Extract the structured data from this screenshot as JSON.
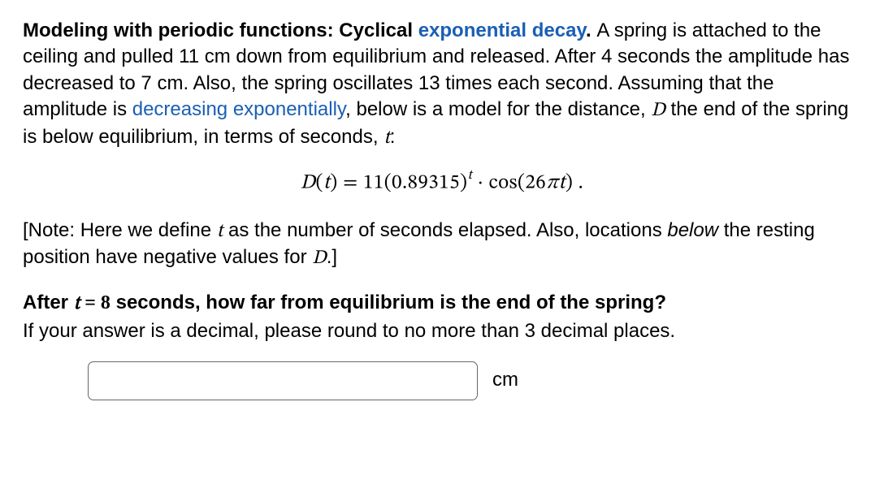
{
  "intro": {
    "title_bold": "Modeling with periodic functions: Cyclical ",
    "title_link": "exponential decay",
    "title_after": ". ",
    "body_part1": "A spring is attached to the ceiling and pulled 11 cm down from equilibrium and released. After 4 seconds the amplitude has decreased to 7 cm. Also, the spring oscillates 13 times each second. Assuming that the amplitude is ",
    "body_link2": "decreasing exponentially",
    "body_part2": ", below is a model for the distance, ",
    "body_D": "D",
    "body_part3": " the end of the spring is below equilibrium, in terms of seconds, ",
    "body_t": "t",
    "body_end": ":"
  },
  "formula": {
    "D": "D",
    "open": "(",
    "t": "t",
    "close_eq": ") = 11(0.89315)",
    "sup": "t",
    "dot_cos": " · cos(26",
    "pi": "π",
    "t2": "t",
    "end": ")  ."
  },
  "note": {
    "open": "[Note: Here we define ",
    "t": "t",
    "mid": " as the number of seconds elapsed. Also, locations ",
    "below_word": "below",
    "mid2": " the resting position have negative values for ",
    "D": "D",
    "close": ".]"
  },
  "question": {
    "line1_pre": "After ",
    "line1_t": "t",
    "line1_eq": " = 8",
    "line1_post": " seconds, how far from equilibrium is the end of the spring?",
    "line2": "If your answer is a decimal, please round to no more than 3 decimal places."
  },
  "answer": {
    "unit": "cm",
    "value": ""
  }
}
